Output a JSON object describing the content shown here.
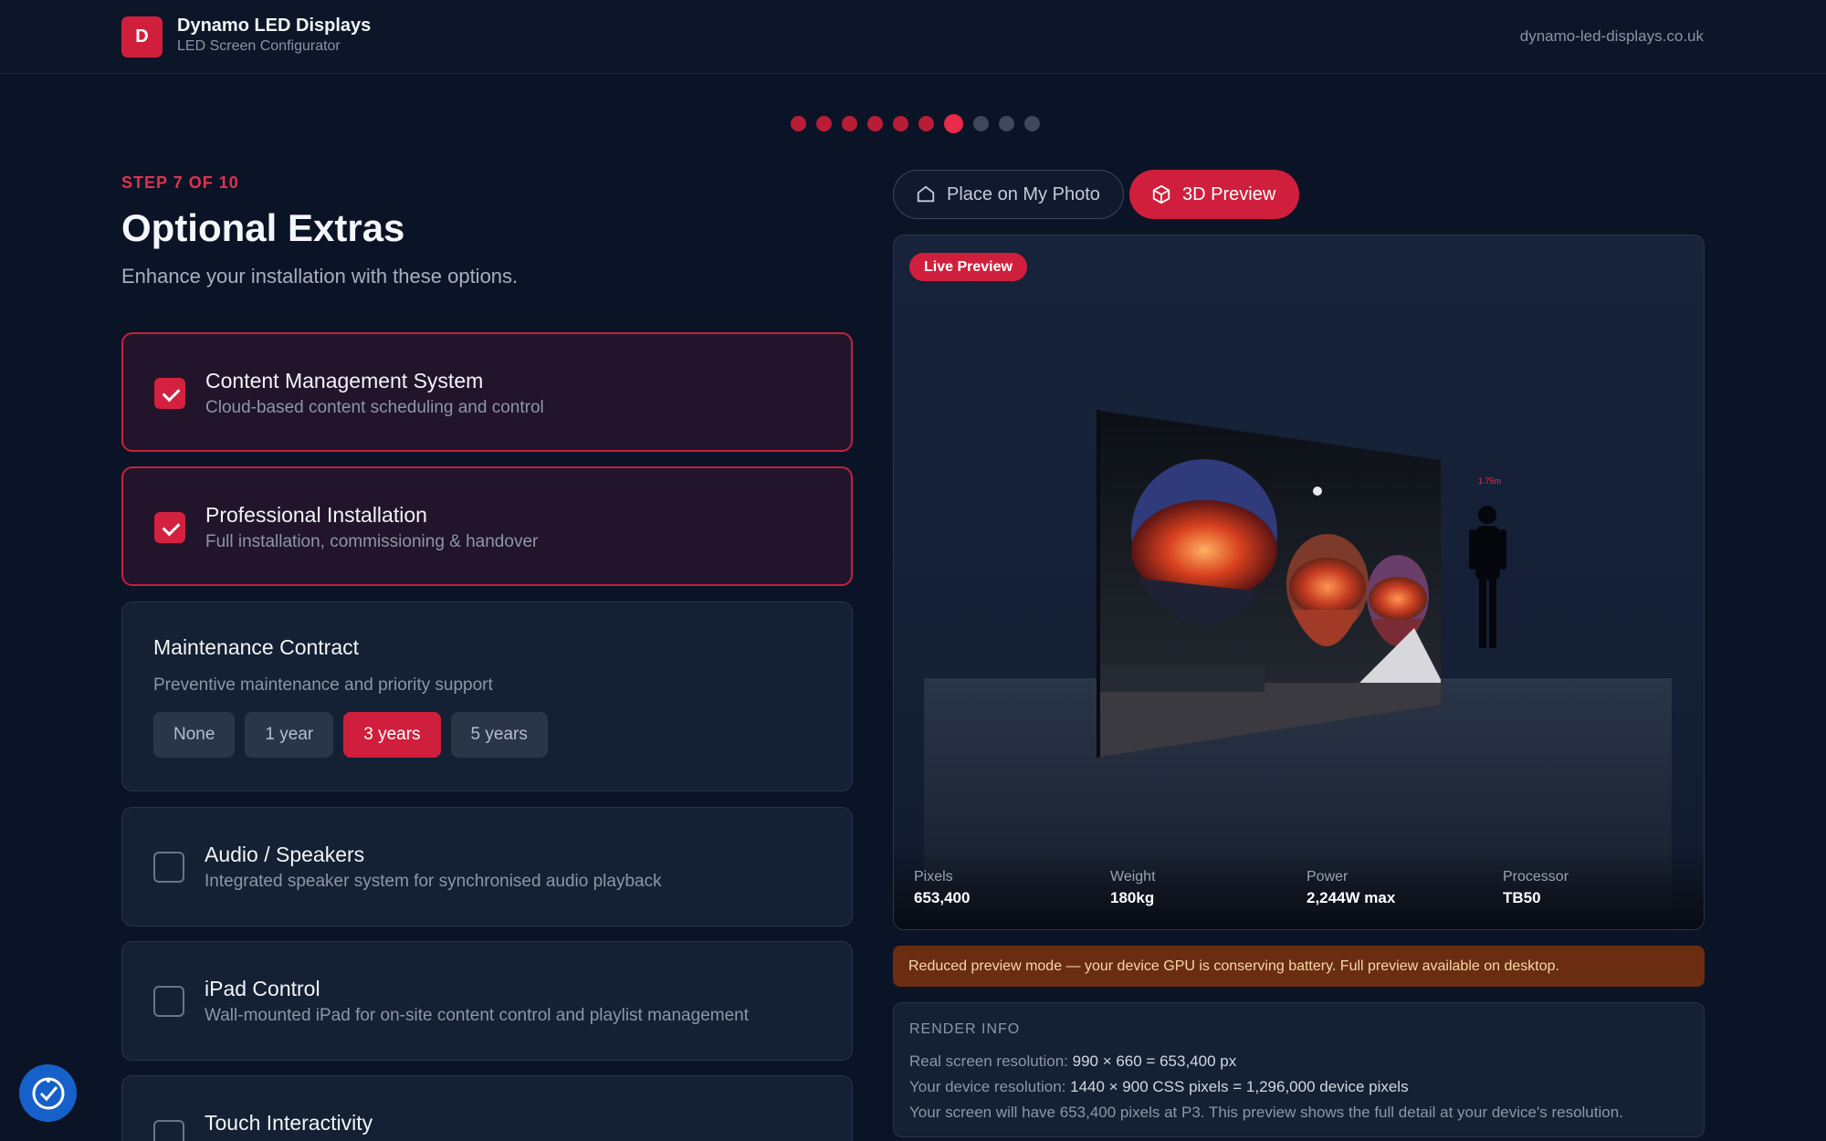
{
  "header": {
    "logo_letter": "D",
    "brand_name": "Dynamo LED Displays",
    "brand_sub": "LED Screen Configurator",
    "site": "dynamo-led-displays.co.uk"
  },
  "progress": {
    "current_step": 7,
    "total_steps": 10
  },
  "step": {
    "label": "STEP 7 OF 10",
    "title": "Optional Extras",
    "subtitle": "Enhance your installation with these options."
  },
  "extras": [
    {
      "title": "Content Management System",
      "desc": "Cloud-based content scheduling and control",
      "checked": true
    },
    {
      "title": "Professional Installation",
      "desc": "Full installation, commissioning & handover",
      "checked": true
    },
    {
      "title": "Audio / Speakers",
      "desc": "Integrated speaker system for synchronised audio playback",
      "checked": false
    },
    {
      "title": "iPad Control",
      "desc": "Wall-mounted iPad for on-site content control and playlist management",
      "checked": false
    },
    {
      "title": "Touch Interactivity",
      "desc": "",
      "checked": false
    }
  ],
  "maintenance": {
    "title": "Maintenance Contract",
    "desc": "Preventive maintenance and priority support",
    "options": [
      "None",
      "1 year",
      "3 years",
      "5 years"
    ],
    "selected": "3 years"
  },
  "preview_tabs": {
    "photo": "Place on My Photo",
    "three_d": "3D Preview",
    "active": "3D Preview"
  },
  "preview": {
    "badge": "Live Preview",
    "person_height": "1.75m",
    "stats": [
      {
        "label": "Pixels",
        "value": "653,400"
      },
      {
        "label": "Weight",
        "value": "180kg"
      },
      {
        "label": "Power",
        "value": "2,244W max"
      },
      {
        "label": "Processor",
        "value": "TB50"
      }
    ]
  },
  "warning": "Reduced preview mode — your device GPU is conserving battery. Full preview available on desktop.",
  "render_info": {
    "title": "RENDER INFO",
    "real_label": "Real screen resolution:",
    "real_value": "990 × 660 = 653,400 px",
    "device_label": "Your device resolution:",
    "device_value": "1440 × 900 CSS pixels = 1,296,000 device pixels",
    "summary": "Your screen will have 653,400 pixels at P3. This preview shows the full detail at your device's resolution."
  },
  "colors": {
    "accent": "#d01f3c",
    "background": "#0b1426",
    "card": "#142033",
    "warning_bg": "#6a2d12"
  },
  "icons": {
    "photo_tab": "home-outline-icon",
    "three_d_tab": "cube-icon",
    "a11y": "accessibility-check-icon"
  }
}
